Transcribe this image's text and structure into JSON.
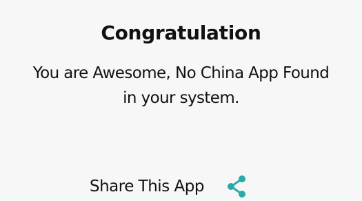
{
  "dialog": {
    "title": "Congratulation",
    "message_line1": "You are Awesome, No China App Found",
    "message_line2": "in your system.",
    "share_label": "Share This App",
    "share_icon": "share-icon",
    "accent_color": "#2aa9a8"
  }
}
